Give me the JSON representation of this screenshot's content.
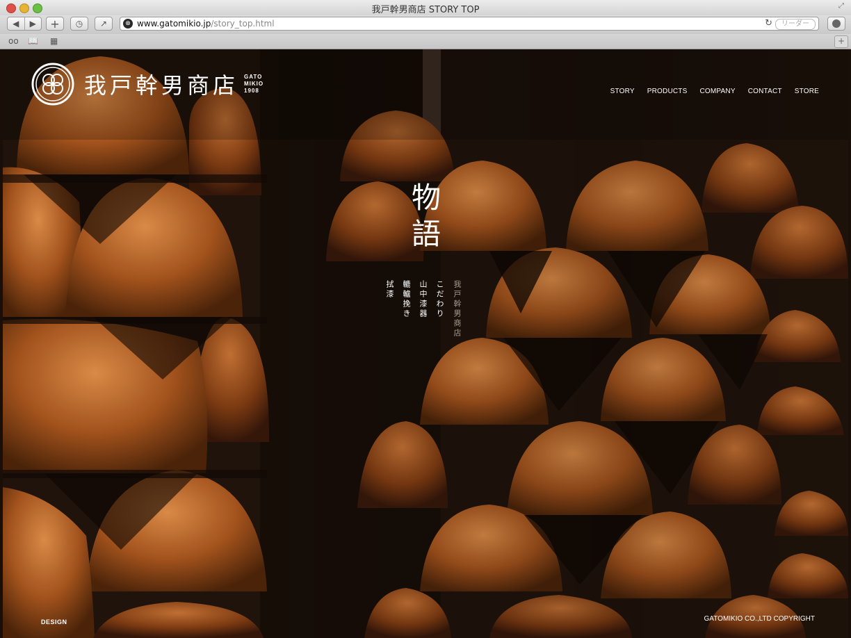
{
  "browser": {
    "window_title": "我戸幹男商店 STORY TOP",
    "url_host": "www.gatomikio.jp",
    "url_path": "/story_top.html",
    "reader_label": "リーダー",
    "icons": {
      "back": "◀",
      "forward": "▶",
      "add_tab": "+",
      "history": "◷",
      "share": "↗",
      "reload": "↻",
      "reading_list": "oo",
      "bookmarks": "📖",
      "top_sites": "▦",
      "new_tab": "+"
    }
  },
  "site": {
    "logo_text": "我戸幹男商店",
    "logo_sub": [
      "GATO",
      "MIKIO",
      "1908"
    ],
    "nav": [
      "STORY",
      "PRODUCTS",
      "COMPANY",
      "CONTACT",
      "STORE"
    ],
    "hero_title": [
      "物",
      "語"
    ],
    "story_links": [
      "我戸幹男商店",
      "こだわり",
      "山中漆器",
      "轆轤挽き",
      "拭漆"
    ],
    "footer_left": "DESIGN",
    "footer_right": "GATOMIKIO CO.,LTD COPYRIGHT"
  },
  "colors": {
    "accent_wood": "#b5652a",
    "background_dark": "#1d120a"
  }
}
